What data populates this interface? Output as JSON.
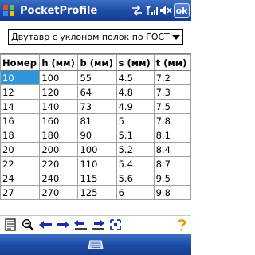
{
  "titlebar": {
    "title": "PocketProfile",
    "ok_label": "ok"
  },
  "profile_select": {
    "value": "Двутавр с уклоном полок по ГОСТ"
  },
  "table": {
    "columns": [
      "Номер",
      "h (мм)",
      "b (мм)",
      "s (мм)",
      "t (мм)"
    ],
    "rows": [
      [
        "10",
        "100",
        "55",
        "4.5",
        "7.2"
      ],
      [
        "12",
        "120",
        "64",
        "4.8",
        "7.3"
      ],
      [
        "14",
        "140",
        "73",
        "4.9",
        "7.5"
      ],
      [
        "16",
        "160",
        "81",
        "5",
        "7.8"
      ],
      [
        "18",
        "180",
        "90",
        "5.1",
        "8.1"
      ],
      [
        "20",
        "200",
        "100",
        "5.2",
        "8.4"
      ],
      [
        "22",
        "220",
        "110",
        "5.4",
        "8.7"
      ],
      [
        "24",
        "240",
        "115",
        "5.6",
        "9.5"
      ],
      [
        "27",
        "270",
        "125",
        "6",
        "9.8"
      ]
    ]
  },
  "colors": {
    "titlebar": "#1c4aa4",
    "selection": "#2f97d9"
  },
  "icons": {
    "toolbar": [
      "document-icon",
      "zoom-out-icon",
      "arrow-left-icon",
      "arrow-right-icon",
      "arrow-left-bar-icon",
      "arrow-right-bar-icon",
      "fit-icon",
      "help-icon"
    ],
    "tray": [
      "connectivity-icon",
      "signal-icon",
      "volume-icon"
    ]
  }
}
